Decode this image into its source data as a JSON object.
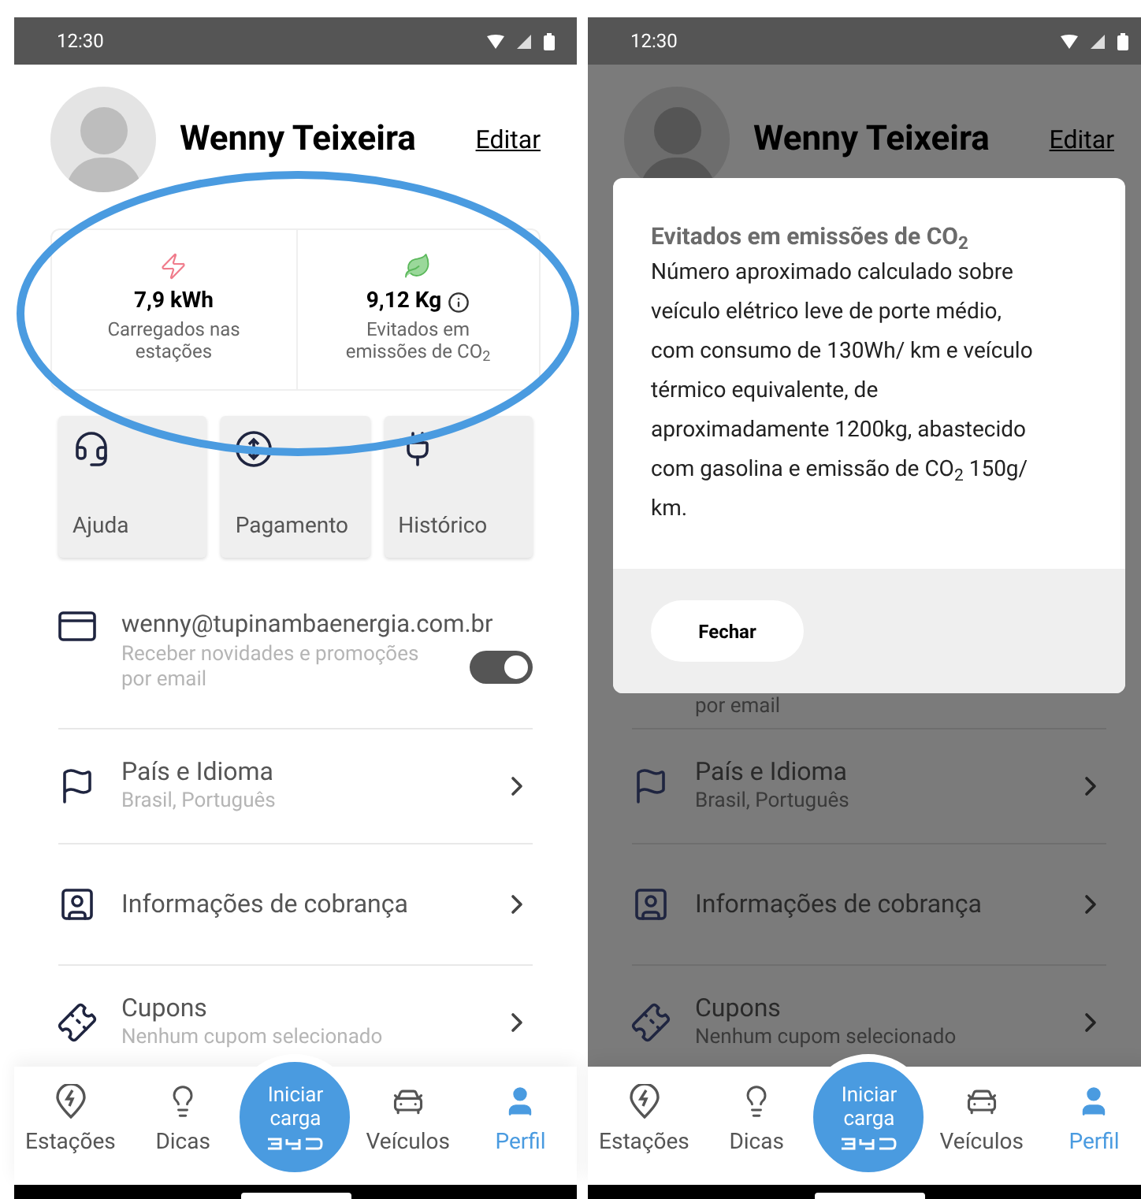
{
  "screens": [
    {
      "kind": "profile",
      "status_bar": {
        "time": "12:30"
      },
      "profile": {
        "name": "Wenny Teixeira",
        "edit_link": "Editar"
      },
      "stats": [
        {
          "kind": "energy",
          "value": "7,9 kWh",
          "label": "Carregados nas estações"
        },
        {
          "kind": "co2",
          "value": "9,12 Kg",
          "label": "Evitados em emissões de CO$_{2}$"
        }
      ],
      "quick_actions": [
        {
          "kind": "help",
          "label": "Ajuda"
        },
        {
          "kind": "payment",
          "label": "Pagamento"
        },
        {
          "kind": "history",
          "label": "Histórico"
        }
      ],
      "email": {
        "address": "wenny@tupinambaenergia.com.br",
        "subtitle": "Receber novidades e promoções por email",
        "toggle_on": true
      },
      "settings": [
        {
          "kind": "flag",
          "title": "País e Idioma",
          "subtitle": "Brasil, Português"
        },
        {
          "kind": "billing",
          "title": "Informações de cobrança"
        },
        {
          "kind": "coupon",
          "title": "Cupons",
          "subtitle": "Nenhum cupom selecionado"
        }
      ],
      "nav": {
        "items": [
          {
            "kind": "stations",
            "label": "Estações",
            "selected": false
          },
          {
            "kind": "tips",
            "label": "Dicas",
            "selected": false
          },
          {
            "kind": "start",
            "label": "Iniciar carga",
            "selected": false
          },
          {
            "kind": "vehicles",
            "label": "Veículos",
            "selected": false
          },
          {
            "kind": "profile",
            "label": "Perfil",
            "selected": true
          }
        ]
      }
    },
    {
      "kind": "dialog",
      "status_bar": {
        "time": "12:30"
      },
      "profile": {
        "name": "Wenny Teixeira",
        "edit_link": "Editar"
      },
      "email_fragment": "por email",
      "dialog": {
        "title": "Evitados em emissões de CO$_{2}$",
        "body": "Número aproximado calculado sobre veículo elétrico leve de porte médio, com consumo de 130Wh/ km e veículo térmico equivalente, de aproximadamente 1200kg, abastecido com gasolina e emissão de CO$_{2}$ 150g/ km.",
        "button": "Fechar"
      },
      "settings": [
        {
          "kind": "flag",
          "title": "País e Idioma",
          "subtitle": "Brasil, Português"
        },
        {
          "kind": "billing",
          "title": "Informações de cobrança"
        },
        {
          "kind": "coupon",
          "title": "Cupons",
          "subtitle": "Nenhum cupom selecionado"
        }
      ],
      "nav": {
        "items": [
          {
            "kind": "stations",
            "label": "Estações",
            "selected": false
          },
          {
            "kind": "tips",
            "label": "Dicas",
            "selected": false
          },
          {
            "kind": "start",
            "label": "Iniciar carga",
            "selected": false
          },
          {
            "kind": "vehicles",
            "label": "Veículos",
            "selected": false
          },
          {
            "kind": "profile",
            "label": "Perfil",
            "selected": true
          }
        ]
      }
    }
  ]
}
